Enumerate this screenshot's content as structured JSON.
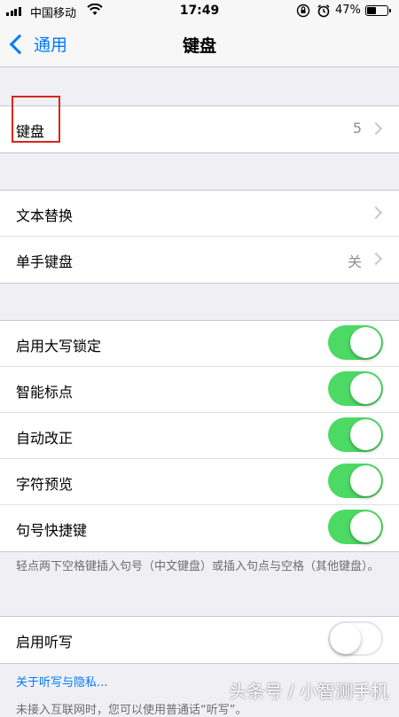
{
  "status_bar": {
    "carrier": "中国移动",
    "time": "17:49",
    "battery": "47%",
    "battery_level": 0.47,
    "icons": [
      "signal-icon",
      "wifi-icon",
      "orientation-lock-icon",
      "alarm-icon",
      "battery-icon"
    ]
  },
  "nav": {
    "back_label": "通用",
    "title": "键盘"
  },
  "group1": {
    "keyboards_label": "键盘",
    "keyboards_count": "5"
  },
  "group2": {
    "text_replacement": "文本替换",
    "one_handed_label": "单手键盘",
    "one_handed_value": "关"
  },
  "group3": {
    "items": [
      {
        "label": "启用大写锁定",
        "on": true
      },
      {
        "label": "智能标点",
        "on": true
      },
      {
        "label": "自动改正",
        "on": true
      },
      {
        "label": "字符预览",
        "on": true
      },
      {
        "label": "句号快捷键",
        "on": true
      }
    ],
    "footnote": "轻点两下空格键插入句号（中文键盘）或插入句点与空格（其他键盘）。"
  },
  "group4": {
    "dictation_label": "启用听写",
    "dictation_on": false,
    "privacy_link": "关于听写与隐私...",
    "cutoff_text": "未接入互联网时，您可以使用普通话“听写”。"
  },
  "watermark": "头条号 / 小智测手机",
  "colors": {
    "accent": "#007aff",
    "toggle_on": "#4cd964",
    "highlight": "#d9251d"
  }
}
